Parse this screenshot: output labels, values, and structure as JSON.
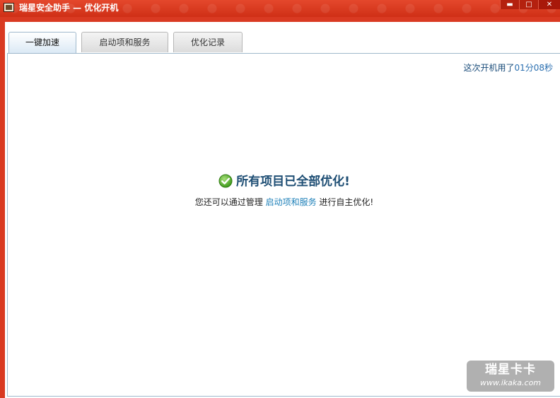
{
  "window": {
    "title": "瑞星安全助手 — 优化开机",
    "controls": {
      "minimize": "▬",
      "maximize": "□",
      "close": "✕"
    }
  },
  "tabs": [
    {
      "label": "一键加速",
      "active": true
    },
    {
      "label": "启动项和服务",
      "active": false
    },
    {
      "label": "优化记录",
      "active": false
    }
  ],
  "status": {
    "boot_time_prefix": "这次开机用了",
    "boot_time_value": "01分08秒"
  },
  "result": {
    "title": "所有项目已全部优化!",
    "hint_prefix": "您还可以通过管理 ",
    "hint_link": "启动项和服务",
    "hint_suffix": " 进行自主优化!"
  },
  "watermark": {
    "main": "瑞星卡卡",
    "sub": "www.ikaka.com"
  },
  "colors": {
    "titlebar": "#d93a22",
    "success_check": "#5bb52a",
    "link": "#1c7fb8"
  }
}
